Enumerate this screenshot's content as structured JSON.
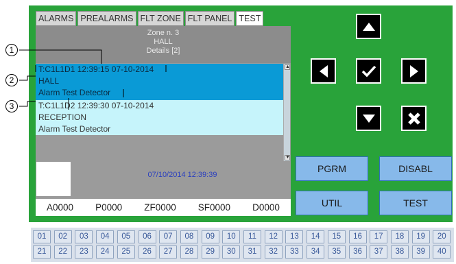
{
  "tabs": [
    {
      "label": "ALARMS"
    },
    {
      "label": "PREALARMS"
    },
    {
      "label": "FLT ZONE"
    },
    {
      "label": "FLT PANEL"
    },
    {
      "label": "TEST"
    }
  ],
  "zone": {
    "line1": "Zone n. 3",
    "line2": "HALL",
    "line3": "Details [2]"
  },
  "events": [
    {
      "id_time": "T:C1L1D1 12:39:15 07-10-2014",
      "location": "HALL",
      "description": "Alarm Test Detector"
    },
    {
      "id_time": "T:C1L1D2 12:39:30 07-10-2014",
      "location": "RECEPTION",
      "description": "Alarm Test Detector"
    }
  ],
  "datetime": "07/10/2014 12:39:39",
  "counters": [
    "A0000",
    "P0000",
    "ZF0000",
    "SF0000",
    "D0000"
  ],
  "buttons": {
    "pgrm": "PGRM",
    "disabl": "DISABL",
    "util": "UTIL",
    "test": "TEST"
  },
  "nav_icons": [
    "up-arrow-icon",
    "left-arrow-icon",
    "check-icon",
    "right-arrow-icon",
    "down-arrow-icon",
    "cancel-icon"
  ],
  "callouts": [
    "1",
    "2",
    "3"
  ],
  "zone_numbers": [
    "01",
    "02",
    "03",
    "04",
    "05",
    "06",
    "07",
    "08",
    "09",
    "10",
    "11",
    "12",
    "13",
    "14",
    "15",
    "16",
    "17",
    "18",
    "19",
    "20",
    "21",
    "22",
    "23",
    "24",
    "25",
    "26",
    "27",
    "28",
    "29",
    "30",
    "31",
    "32",
    "33",
    "34",
    "35",
    "36",
    "37",
    "38",
    "39",
    "40"
  ],
  "colors": {
    "panel_green": "#29a33a",
    "selected_event": "#0a9ad6",
    "event_bg": "#c6f4fb",
    "function_button": "#87b9ea",
    "zone_cell_text": "#3a5a9a"
  }
}
